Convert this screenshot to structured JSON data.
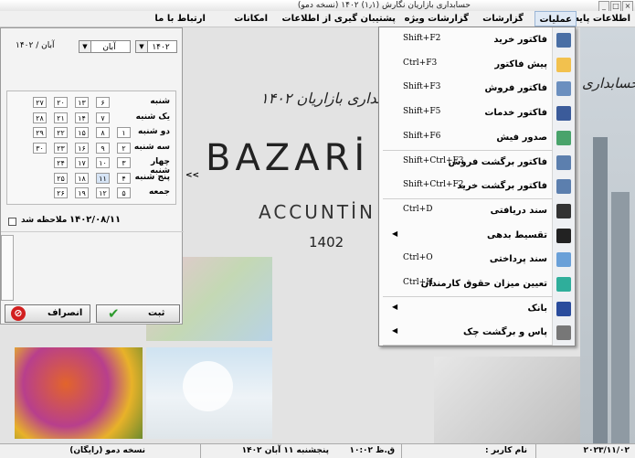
{
  "window": {
    "title": "حسابداری بازاریان نگارش (۱٫۱) ۱۴۰۲ (نسخه دمو)"
  },
  "menubar": {
    "items": [
      {
        "label": "اطلاعات پایه"
      },
      {
        "label": "عملیات"
      },
      {
        "label": "گزارشات"
      },
      {
        "label": "گزارشات ویژه"
      },
      {
        "label": "پشتیبان گیری از اطلاعات"
      },
      {
        "label": "امکانات"
      },
      {
        "label": "ارتباط با ما"
      }
    ]
  },
  "operations_menu": {
    "items": [
      {
        "label": "فاکتور خرید",
        "shortcut": "Shift+F2",
        "icon": "pen-icon"
      },
      {
        "label": "پیش فاکتور",
        "shortcut": "Ctrl+F3",
        "icon": "document-coin-icon"
      },
      {
        "label": "فاکتور فروش",
        "shortcut": "Shift+F3",
        "icon": "invoice-icon"
      },
      {
        "label": "فاکتور خدمات",
        "shortcut": "Shift+F5",
        "icon": "service-invoice-icon"
      },
      {
        "label": "صدور فیش",
        "shortcut": "Shift+F6",
        "icon": "receipt-icon"
      },
      {
        "label": "فاکتور برگشت فروش",
        "shortcut": "Shift+Ctrl+F3",
        "icon": "return-sale-icon"
      },
      {
        "label": "فاکتور برگشت خرید",
        "shortcut": "Shift+Ctrl+F2",
        "icon": "return-purchase-icon"
      },
      {
        "label": "سند دریافتی",
        "shortcut": "Ctrl+D",
        "icon": "received-doc-icon"
      },
      {
        "label": "تقسیط بدهی",
        "shortcut": "",
        "icon": "installment-icon",
        "submenu": true
      },
      {
        "label": "سند پرداختی",
        "shortcut": "Ctrl+O",
        "icon": "payment-doc-icon"
      },
      {
        "label": "تعیین میزان حقوق کارمندان",
        "shortcut": "Ctrl+H",
        "icon": "salary-icon"
      },
      {
        "label": "بانک",
        "shortcut": "",
        "icon": "bank-icon",
        "submenu": true
      },
      {
        "label": "پاس و برگشت چک",
        "shortcut": "",
        "icon": "check-icon",
        "submenu": true
      }
    ]
  },
  "calendar": {
    "year": "۱۴۰۲",
    "month": "آبان",
    "header_display": "آبان / ۱۴۰۲",
    "days": [
      "شنبه",
      "یک شنبه",
      "دو شنبه",
      "سه شنبه",
      "چهار شنبه",
      "پنج شنبه",
      "جمعه"
    ],
    "weeks": [
      [
        "",
        "",
        "1",
        "2",
        "3",
        "4",
        "5"
      ],
      [
        "6",
        "7",
        "8",
        "9",
        "10",
        "11",
        "12"
      ],
      [
        "13",
        "14",
        "15",
        "16",
        "17",
        "18",
        "19"
      ],
      [
        "20",
        "21",
        "22",
        "23",
        "24",
        "25",
        "26"
      ],
      [
        "27",
        "28",
        "29",
        "30",
        "",
        "",
        ""
      ]
    ],
    "weeks_display": [
      [
        "",
        "",
        "۱",
        "۲",
        "۳",
        "۴",
        "۵"
      ],
      [
        "۶",
        "۷",
        "۸",
        "۹",
        "۱۰",
        "۱۱",
        "۱۲"
      ],
      [
        "۱۳",
        "۱۴",
        "۱۵",
        "۱۶",
        "۱۷",
        "۱۸",
        "۱۹"
      ],
      [
        "۲۰",
        "۲۱",
        "۲۲",
        "۲۳",
        "۲۴",
        "۲۵",
        "۲۶"
      ],
      [
        "۲۷",
        "۲۸",
        "۲۹",
        "۳۰",
        "",
        "",
        ""
      ]
    ],
    "today_value": "11",
    "selected_date": "۱۴۰۲/۰۸/۱۱",
    "ack_label": "ملاحظه شد",
    "collapse_glyph": "<<"
  },
  "buttons": {
    "submit": "ثبت",
    "cancel": "انصراف"
  },
  "logo": {
    "title_fa": "حسابداری بازاریان ۱۴۰۲",
    "brand": "BAZARİ",
    "sub": "ACCUNTİN",
    "year": "1402"
  },
  "city_logo": "حسابداری",
  "status_bar": {
    "date": "۲۰۲۳/۱۱/۰۲",
    "user_label": "نام کاربر :",
    "code": "ق.ظ ۱۰:۰۲",
    "weekday_date": "پنجشنبه ۱۱ آبان ۱۴۰۲",
    "edition": "نسخه دمو (رایگان)"
  },
  "colors": {
    "menu_highlight": "#dfe9f5",
    "panel_bg": "#f3f3f3",
    "accent_green": "#2e9b2e",
    "accent_red": "#d21f1f"
  }
}
